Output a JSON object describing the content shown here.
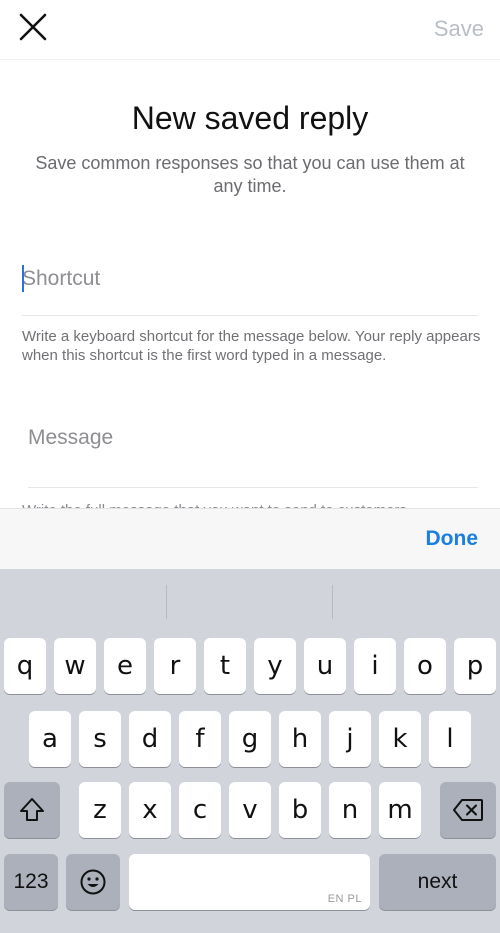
{
  "header": {
    "save_label": "Save"
  },
  "main": {
    "title": "New saved reply",
    "subtitle": "Save common responses so that you can use them at any time.",
    "shortcut_placeholder": "Shortcut",
    "shortcut_help": "Write a keyboard shortcut for the message below. Your reply appears when this shortcut is the first word typed in a message.",
    "message_placeholder": "Message",
    "message_help": "Write the full message that you want to send to customers."
  },
  "accessory": {
    "done_label": "Done"
  },
  "keyboard": {
    "row1": [
      "q",
      "w",
      "e",
      "r",
      "t",
      "y",
      "u",
      "i",
      "o",
      "p"
    ],
    "row2": [
      "a",
      "s",
      "d",
      "f",
      "g",
      "h",
      "j",
      "k",
      "l"
    ],
    "row3": [
      "z",
      "x",
      "c",
      "v",
      "b",
      "n",
      "m"
    ],
    "numbers_label": "123",
    "return_label": "next",
    "space_language": "EN PL",
    "icons": {
      "shift": "shift-arrow-icon",
      "delete": "backspace-icon",
      "emoji": "emoji-smiley-icon",
      "close": "close-x-icon"
    }
  },
  "colors": {
    "accent": "#1b7fe0",
    "caret": "#2f6fe4",
    "save_disabled": "#b9bdc4",
    "keyboard_bg": "#d1d4da"
  }
}
